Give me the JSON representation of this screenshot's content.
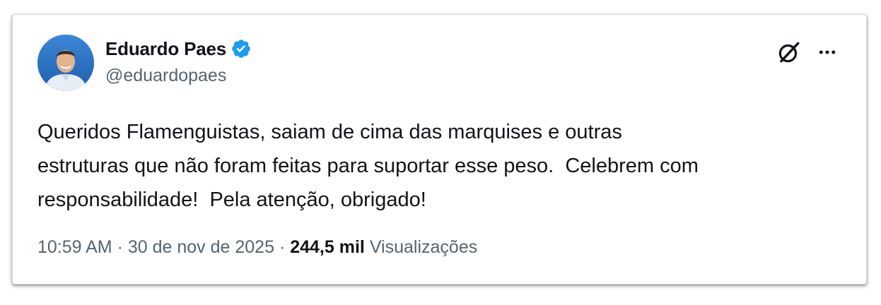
{
  "author": {
    "name": "Eduardo Paes",
    "handle": "@eduardopaes",
    "verified": true,
    "verified_color": "#1d9bf0"
  },
  "icons": {
    "grok": "grok-icon",
    "more": "more-options-icon",
    "verified": "verified-badge-icon"
  },
  "tweet": {
    "text": "Queridos Flamenguistas, saiam de cima das marquises e outras\nestruturas que não foram feitas para suportar esse peso.  Celebrem com\nresponsabilidade!  Pela atenção, obrigado!"
  },
  "meta": {
    "time": "10:59 AM",
    "sep1": " · ",
    "date": "30 de nov de 2025",
    "sep2": " · ",
    "views_count": "244,5 mil",
    "views_label": "Visualizações"
  }
}
